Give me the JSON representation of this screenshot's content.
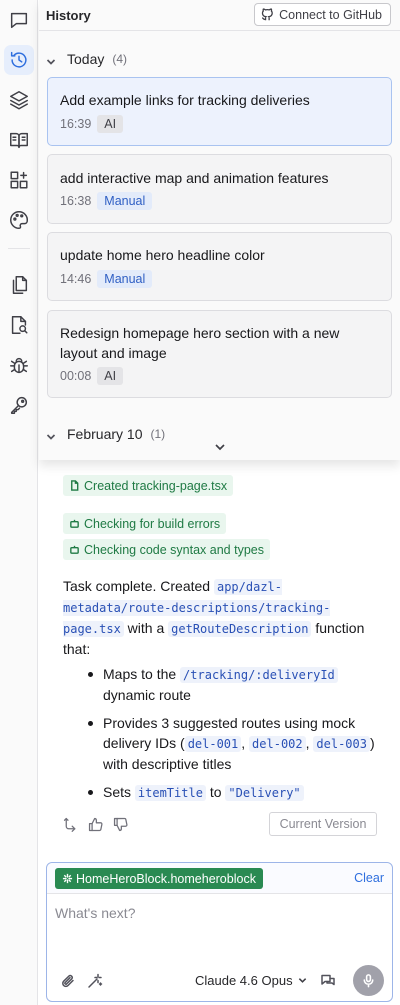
{
  "history": {
    "title": "History",
    "github_button": "Connect to GitHub",
    "groups": [
      {
        "label": "Today",
        "count": "(4)"
      },
      {
        "label": "February 10",
        "count": "(1)"
      }
    ],
    "items": [
      {
        "title": "Add example links for tracking deliveries",
        "time": "16:39",
        "badge": "AI"
      },
      {
        "title": "add interactive map and animation features",
        "time": "16:38",
        "badge": "Manual"
      },
      {
        "title": "update home hero headline color",
        "time": "14:46",
        "badge": "Manual"
      },
      {
        "title": "Redesign homepage hero section with a new layout and image",
        "time": "00:08",
        "badge": "AI"
      }
    ]
  },
  "chat": {
    "created_chip": "Created tracking-page.tsx",
    "status_chips": [
      "Checking for build errors",
      "Checking code syntax and types"
    ],
    "message": {
      "p1": "Task complete. Created ",
      "file": "app/dazl-metadata/route-descriptions/tracking-page.tsx",
      "p2": " with a ",
      "fn": "getRouteDescription",
      "p3": " function that:"
    },
    "bullets": {
      "b1_pre": "Maps to the ",
      "b1_code": "/tracking/:deliveryId",
      "b1_post": " dynamic route",
      "b2_pre": "Provides 3 suggested routes using mock delivery IDs (",
      "b2_code1": "del-001",
      "b2_sep1": ", ",
      "b2_code2": "del-002",
      "b2_sep2": ", ",
      "b2_code3": "del-003",
      "b2_post": ") with descriptive titles",
      "b3_pre": "Sets ",
      "b3_code1": "itemTitle",
      "b3_mid": " to ",
      "b3_code2": "\"Delivery\""
    },
    "version_button": "Current Version"
  },
  "composer": {
    "context_chip": "HomeHeroBlock.homeheroblock",
    "clear_label": "Clear",
    "placeholder": "What's next?",
    "model": "Claude 4.6 Opus"
  },
  "rail_icons": [
    "chat-icon",
    "history-icon",
    "layers-icon",
    "book-icon",
    "components-icon",
    "palette-icon",
    "files-icon",
    "file-search-icon",
    "bug-icon",
    "key-icon"
  ],
  "colors": {
    "accent": "#2f6fde",
    "success": "#2a8a52",
    "code": "#2950b5"
  }
}
